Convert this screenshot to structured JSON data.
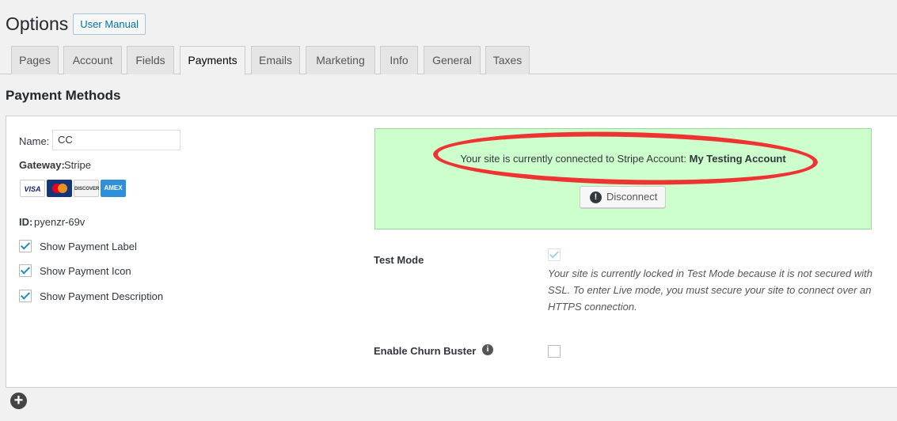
{
  "header": {
    "title": "Options",
    "manual_button": "User Manual"
  },
  "tabs": [
    {
      "label": "Pages"
    },
    {
      "label": "Account"
    },
    {
      "label": "Fields"
    },
    {
      "label": "Payments"
    },
    {
      "label": "Emails"
    },
    {
      "label": "Marketing"
    },
    {
      "label": "Info"
    },
    {
      "label": "General"
    },
    {
      "label": "Taxes"
    }
  ],
  "active_tab": "Payments",
  "section_title": "Payment Methods",
  "method": {
    "name_label": "Name:",
    "name_value": "CC",
    "gateway_label": "Gateway:",
    "gateway_value": "Stripe",
    "cards": [
      "VISA",
      "MasterCard",
      "DISCOVER",
      "AMEX"
    ],
    "id_label": "ID:",
    "id_value": "pyenzr-69v",
    "options": [
      {
        "label": "Show Payment Label",
        "checked": true
      },
      {
        "label": "Show Payment Icon",
        "checked": true
      },
      {
        "label": "Show Payment Description",
        "checked": true
      }
    ]
  },
  "stripe": {
    "connected_prefix": "Your site is currently connected to Stripe Account:",
    "account_name": "My Testing Account",
    "disconnect_label": "Disconnect"
  },
  "test_mode": {
    "label": "Test Mode",
    "checked": true,
    "disabled": true,
    "note": "Your site is currently locked in Test Mode because it is not secured with SSL. To enter Live mode, you must secure your site to connect over an HTTPS connection."
  },
  "churn_buster": {
    "label": "Enable Churn Buster",
    "checked": false
  },
  "colors": {
    "accent": "#0073aa",
    "checkbox": "#1e8cbe",
    "connected_bg": "#ccffcc",
    "highlight": "#ee3333"
  }
}
